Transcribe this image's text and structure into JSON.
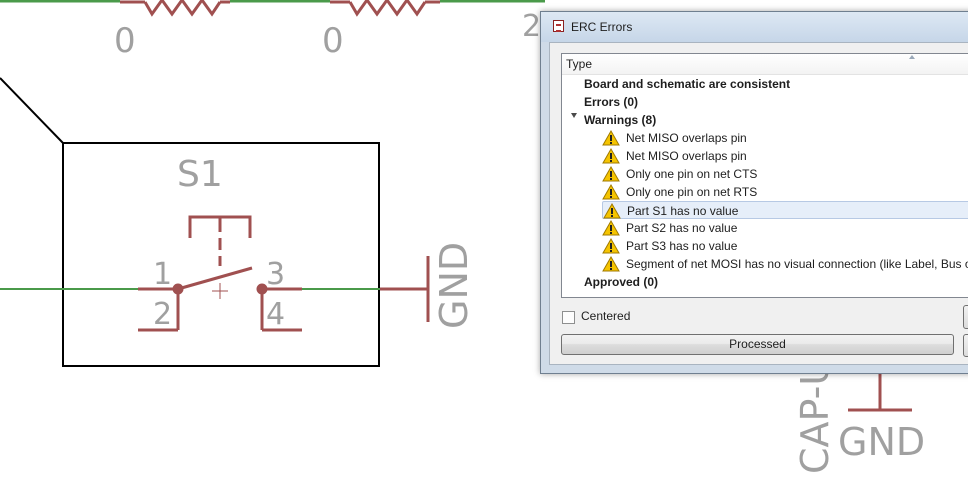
{
  "schematic": {
    "resistor_values": [
      "0",
      "0"
    ],
    "partial_label_left": "2",
    "switch": {
      "name": "S1",
      "pins": [
        "1",
        "2",
        "3",
        "4"
      ]
    },
    "gnd_label_vertical": "GND",
    "gnd_label_bottom": "GND",
    "cap_label": "CAP-U",
    "colors": {
      "wire": "#4a9a4a",
      "component": "#a05050",
      "label": "#a0a0a0",
      "outline": "#000000"
    }
  },
  "dialog": {
    "title": "ERC Errors",
    "column_header": "Type",
    "items": [
      {
        "label": "Board and schematic are consistent",
        "bold": true
      },
      {
        "label": "Errors (0)",
        "bold": true
      },
      {
        "label": "Warnings (8)",
        "bold": true,
        "expanded": true
      },
      {
        "label": "Net MISO overlaps pin",
        "icon": "warning-icon"
      },
      {
        "label": "Net MISO overlaps pin",
        "icon": "warning-icon"
      },
      {
        "label": "Only one pin on net CTS",
        "icon": "warning-icon"
      },
      {
        "label": "Only one pin on net RTS",
        "icon": "warning-icon"
      },
      {
        "label": "Part S1 has no value",
        "icon": "warning-icon",
        "selected": true
      },
      {
        "label": "Part S2 has no value",
        "icon": "warning-icon"
      },
      {
        "label": "Part S3 has no value",
        "icon": "warning-icon"
      },
      {
        "label": "Segment of net MOSI has no visual connection (like Label, Bus or",
        "icon": "warning-icon"
      },
      {
        "label": "Approved (0)",
        "bold": true
      }
    ],
    "centered_label": "Centered",
    "centered_checked": false,
    "processed_button": "Processed"
  }
}
